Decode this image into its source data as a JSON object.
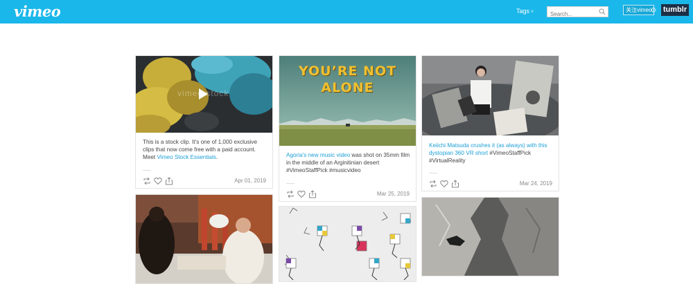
{
  "header": {
    "logo": "vimeo",
    "tags_label": "Tags",
    "tags_chevron": "˅",
    "search_placeholder": "Search...",
    "follow_label": "关注vimeo",
    "tumblr_label": "tumblr",
    "bg_color": "#1ab7ea"
  },
  "posts": [
    {
      "caption_pre": "This is a stock clip. It’s one of 1,000 exclusive clips that now come free with a paid account. Meet ",
      "caption_link": "Vimeo Stock Essentials",
      "caption_post": ".",
      "date": "Apr 01, 2019",
      "overlay_text": "vimeo stock"
    },
    {
      "image_title_line1": "YOU’RE NOT",
      "image_title_line2": "ALONE",
      "caption_link": "Agoria's new music video",
      "caption_post": " was shot on 35mm film in the middle of an Arginitinian desert #VimeoStaffPick #musicvideo",
      "date": "Mar 25, 2019"
    },
    {
      "caption_link": "Keiichi Matsuda crushes it (as always) with this dystopian 360 VR short",
      "caption_post": " #VimeoStaffPick #VirtualReality",
      "date": "Mar 24, 2019"
    }
  ],
  "icons": {
    "reblog": "reblog-icon",
    "like": "heart-icon",
    "share": "share-icon",
    "search": "search-icon"
  }
}
